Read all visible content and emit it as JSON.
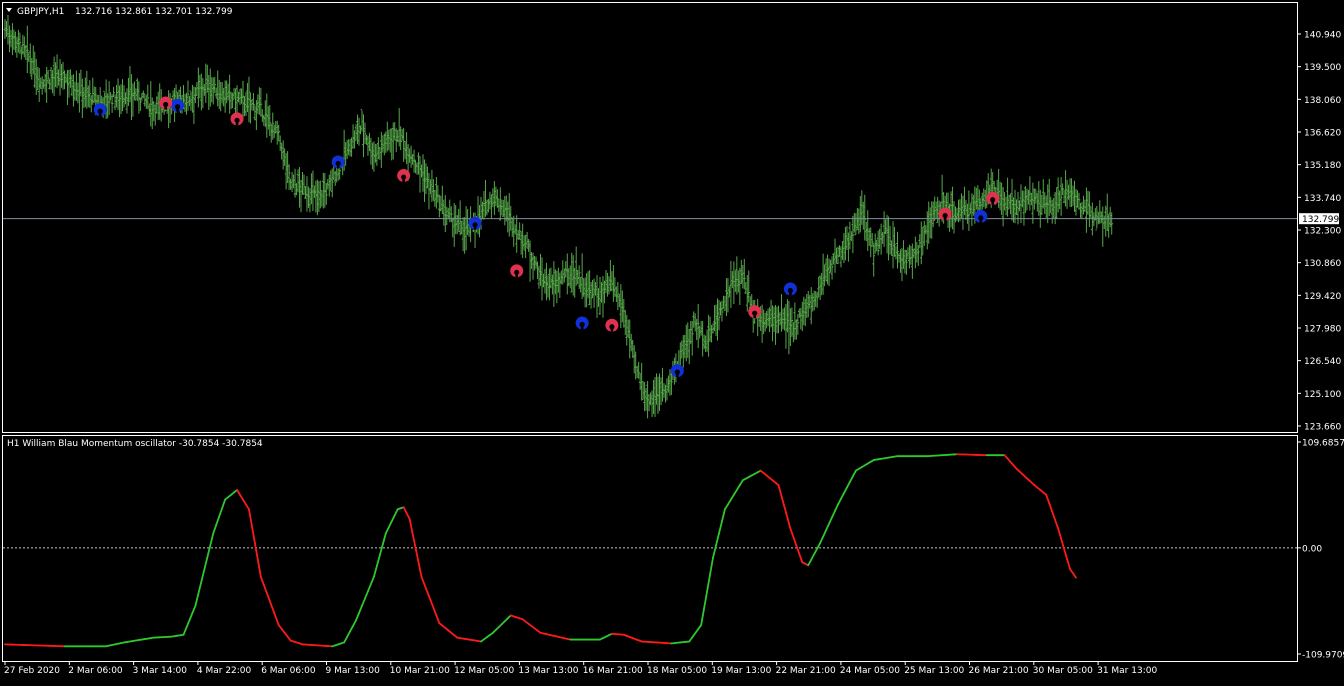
{
  "colors": {
    "background": "#000000",
    "frame": "#ffffff",
    "bars": "#57a84b",
    "current_price_line": "#7d8f9e",
    "buy_signal": "#1030d8",
    "sell_signal": "#e0324f",
    "osc_rising": "#2ec82e",
    "osc_falling": "#ff1a1a",
    "zero_line": "#c8c8c8"
  },
  "header": {
    "menu_icon": "triangle-down-icon",
    "symbol": "GBPJPY,H1",
    "ohlc": "132.716 132.861 132.701 132.799"
  },
  "price_axis": {
    "ticks": [
      "140.940",
      "139.500",
      "138.060",
      "136.620",
      "135.180",
      "133.740",
      "132.300",
      "130.860",
      "129.420",
      "127.980",
      "126.540",
      "125.100",
      "123.660"
    ],
    "current_price": "132.799"
  },
  "oscillator_header": {
    "label": "H1 William Blau Momentum oscillator -30.7854 -30.7854"
  },
  "oscillator_axis": {
    "ticks": [
      "109.6857",
      "0.00",
      "-109.9709"
    ]
  },
  "time_axis": {
    "labels": [
      "27 Feb 2020",
      "2 Mar 06:00",
      "3 Mar 14:00",
      "4 Mar 22:00",
      "6 Mar 06:00",
      "9 Mar 13:00",
      "10 Mar 21:00",
      "12 Mar 05:00",
      "13 Mar 13:00",
      "16 Mar 21:00",
      "18 Mar 05:00",
      "19 Mar 13:00",
      "22 Mar 21:00",
      "24 Mar 05:00",
      "25 Mar 13:00",
      "26 Mar 21:00",
      "30 Mar 05:00",
      "31 Mar 13:00"
    ]
  },
  "chart_data": [
    {
      "type": "bar",
      "symbol": "GBPJPY",
      "timeframe": "H1",
      "ylim": [
        123.66,
        140.94
      ],
      "last_price": 132.799,
      "close_path": [
        [
          0,
          141.2
        ],
        [
          2,
          140.6
        ],
        [
          4,
          139.9
        ],
        [
          6,
          138.8
        ],
        [
          8,
          139.0
        ],
        [
          10,
          139.0
        ],
        [
          13,
          138.4
        ],
        [
          16,
          137.9
        ],
        [
          19,
          138.2
        ],
        [
          22,
          138.3
        ],
        [
          25,
          137.7
        ],
        [
          28,
          137.9
        ],
        [
          31,
          138.1
        ],
        [
          34,
          138.7
        ],
        [
          37,
          138.2
        ],
        [
          40,
          138.0
        ],
        [
          43,
          137.6
        ],
        [
          46,
          136.4
        ],
        [
          48,
          134.4
        ],
        [
          50,
          134.1
        ],
        [
          52,
          133.8
        ],
        [
          54,
          134.0
        ],
        [
          56,
          135.0
        ],
        [
          58,
          136.0
        ],
        [
          60,
          136.9
        ],
        [
          62,
          135.6
        ],
        [
          64,
          136.2
        ],
        [
          66,
          136.6
        ],
        [
          68,
          135.7
        ],
        [
          70,
          134.9
        ],
        [
          72,
          133.9
        ],
        [
          74,
          133.0
        ],
        [
          76,
          132.5
        ],
        [
          78,
          132.3
        ],
        [
          80,
          133.0
        ],
        [
          82,
          133.8
        ],
        [
          84,
          133.2
        ],
        [
          86,
          132.2
        ],
        [
          88,
          131.5
        ],
        [
          90,
          130.2
        ],
        [
          92,
          129.8
        ],
        [
          94,
          130.3
        ],
        [
          96,
          130.4
        ],
        [
          98,
          129.6
        ],
        [
          100,
          129.4
        ],
        [
          102,
          129.9
        ],
        [
          104,
          128.7
        ],
        [
          106,
          126.2
        ],
        [
          108,
          124.8
        ],
        [
          110,
          125.2
        ],
        [
          112,
          125.6
        ],
        [
          114,
          127.0
        ],
        [
          116,
          128.2
        ],
        [
          118,
          127.4
        ],
        [
          120,
          128.6
        ],
        [
          122,
          129.8
        ],
        [
          124,
          130.3
        ],
        [
          126,
          128.6
        ],
        [
          128,
          128.3
        ],
        [
          130,
          128.4
        ],
        [
          132,
          128.0
        ],
        [
          134,
          128.6
        ],
        [
          136,
          129.2
        ],
        [
          138,
          130.5
        ],
        [
          140,
          131.1
        ],
        [
          142,
          132.0
        ],
        [
          144,
          133.0
        ],
        [
          146,
          131.4
        ],
        [
          148,
          132.2
        ],
        [
          150,
          131.2
        ],
        [
          152,
          131.0
        ],
        [
          154,
          131.7
        ],
        [
          156,
          133.0
        ],
        [
          158,
          133.4
        ],
        [
          160,
          133.0
        ],
        [
          162,
          133.2
        ],
        [
          164,
          133.6
        ],
        [
          166,
          134.2
        ],
        [
          168,
          133.4
        ],
        [
          170,
          133.4
        ],
        [
          172,
          133.8
        ],
        [
          174,
          133.5
        ],
        [
          176,
          133.3
        ],
        [
          178,
          134.0
        ],
        [
          180,
          133.5
        ],
        [
          182,
          133.2
        ],
        [
          184,
          132.9
        ],
        [
          186,
          132.8
        ]
      ],
      "buy_signals": [
        [
          16,
          137.6
        ],
        [
          29,
          137.8
        ],
        [
          56,
          135.3
        ],
        [
          79,
          132.6
        ],
        [
          97,
          128.2
        ],
        [
          113,
          126.1
        ],
        [
          132,
          129.7
        ],
        [
          164,
          132.9
        ]
      ],
      "sell_signals": [
        [
          27,
          137.9
        ],
        [
          39,
          137.2
        ],
        [
          67,
          134.7
        ],
        [
          86,
          130.5
        ],
        [
          102,
          128.1
        ],
        [
          126,
          128.7
        ],
        [
          158,
          133.0
        ],
        [
          166,
          133.7
        ]
      ]
    },
    {
      "type": "line",
      "title": "H1 William Blau Momentum oscillator",
      "ylim": [
        -109.9709,
        109.6857
      ],
      "last_value": -30.7854,
      "points": [
        [
          0,
          -100
        ],
        [
          10,
          -102
        ],
        [
          17,
          -102
        ],
        [
          20,
          -98
        ],
        [
          25,
          -93
        ],
        [
          28,
          -92
        ],
        [
          30,
          -90
        ],
        [
          32,
          -60
        ],
        [
          35,
          15
        ],
        [
          37,
          50
        ],
        [
          39,
          60
        ],
        [
          41,
          40
        ],
        [
          43,
          -30
        ],
        [
          46,
          -80
        ],
        [
          48,
          -96
        ],
        [
          50,
          -100
        ],
        [
          55,
          -102
        ],
        [
          57,
          -98
        ],
        [
          59,
          -75
        ],
        [
          62,
          -30
        ],
        [
          64,
          15
        ],
        [
          66,
          40
        ],
        [
          67,
          42
        ],
        [
          68,
          30
        ],
        [
          70,
          -30
        ],
        [
          73,
          -78
        ],
        [
          76,
          -93
        ],
        [
          80,
          -97
        ],
        [
          82,
          -88
        ],
        [
          85,
          -70
        ],
        [
          87,
          -74
        ],
        [
          90,
          -88
        ],
        [
          95,
          -95
        ],
        [
          100,
          -95
        ],
        [
          102,
          -89
        ],
        [
          104,
          -90
        ],
        [
          107,
          -97
        ],
        [
          112,
          -99
        ],
        [
          115,
          -97
        ],
        [
          117,
          -80
        ],
        [
          119,
          -10
        ],
        [
          121,
          40
        ],
        [
          124,
          70
        ],
        [
          127,
          80
        ],
        [
          130,
          65
        ],
        [
          132,
          20
        ],
        [
          134,
          -15
        ],
        [
          135,
          -18
        ],
        [
          137,
          5
        ],
        [
          140,
          45
        ],
        [
          143,
          80
        ],
        [
          146,
          91
        ],
        [
          150,
          95
        ],
        [
          155,
          95
        ],
        [
          160,
          97
        ],
        [
          165,
          96
        ],
        [
          168,
          96
        ],
        [
          170,
          82
        ],
        [
          173,
          65
        ],
        [
          175,
          55
        ],
        [
          177,
          20
        ],
        [
          179,
          -22
        ],
        [
          180,
          -30.8
        ]
      ],
      "segment_color": "green when rising, red when falling"
    }
  ]
}
